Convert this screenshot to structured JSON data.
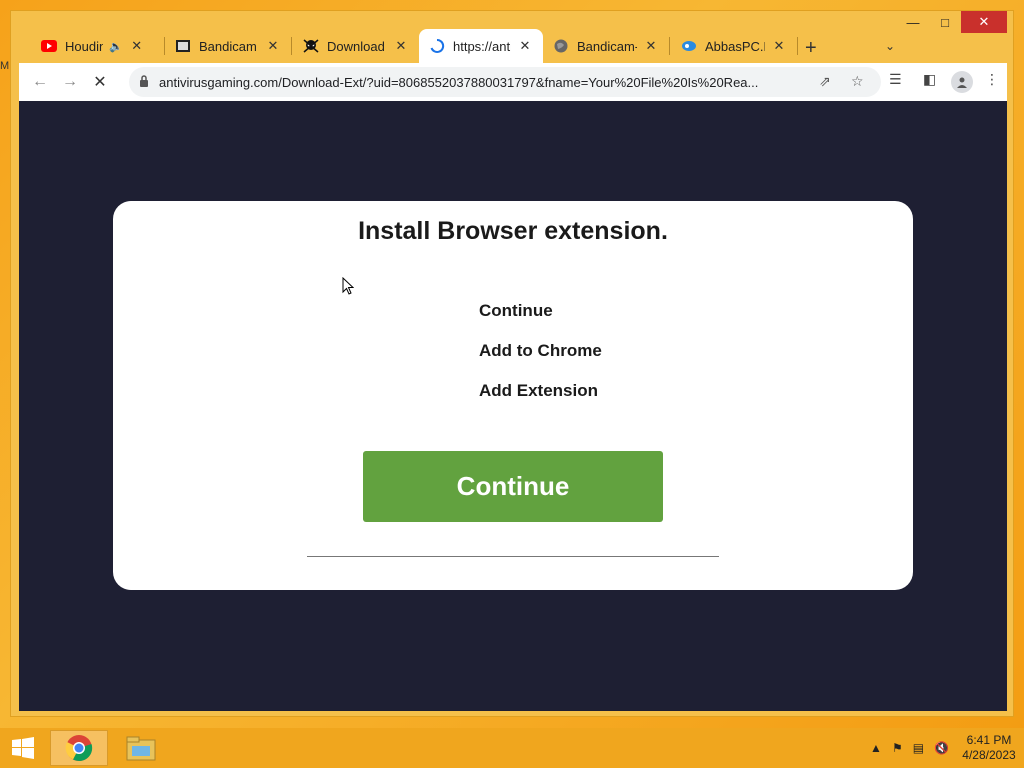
{
  "desktop": {
    "edge_label": "M"
  },
  "tabs": [
    {
      "title": "Houdini",
      "icon": "youtube-icon"
    },
    {
      "title": "Bandicam C",
      "icon": "bandicam-icon"
    },
    {
      "title": "Download",
      "icon": "skull-icon"
    },
    {
      "title": "https://antiv",
      "icon": "loading-spinner-icon"
    },
    {
      "title": "Bandicam-C",
      "icon": "globe-icon"
    },
    {
      "title": "AbbasPC.N",
      "icon": "abbaspc-icon"
    }
  ],
  "browser": {
    "url": "antivirusgaming.com/Download-Ext/?uid=8068552037880031797&fname=Your%20File%20Is%20Rea..."
  },
  "page": {
    "heading": "Install Browser extension.",
    "steps": [
      "Continue",
      "Add to Chrome",
      "Add Extension"
    ],
    "cta_label": "Continue",
    "cta_color": "#62a23f",
    "background_color": "#1e1f33"
  },
  "taskbar": {
    "time": "6:41 PM",
    "date": "4/28/2023"
  }
}
